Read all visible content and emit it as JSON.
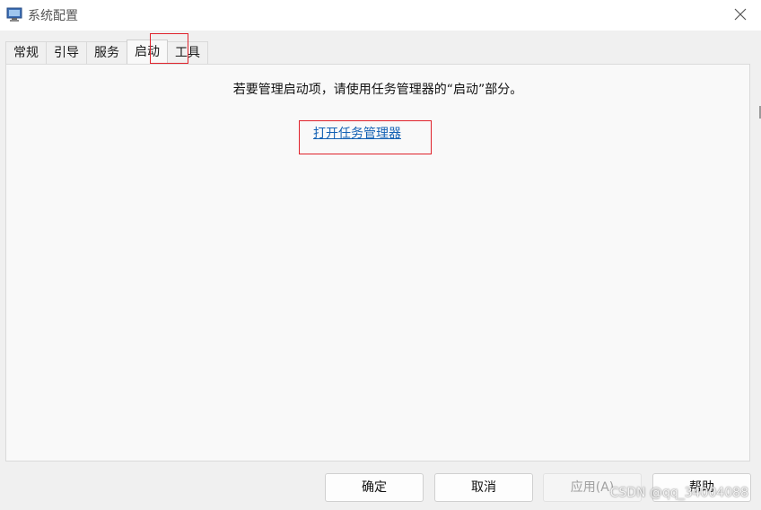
{
  "window": {
    "title": "系统配置",
    "close_icon": "close-icon",
    "app_icon": "system-config-icon"
  },
  "tabs": [
    {
      "label": "常规",
      "active": false
    },
    {
      "label": "引导",
      "active": false
    },
    {
      "label": "服务",
      "active": false
    },
    {
      "label": "启动",
      "active": true
    },
    {
      "label": "工具",
      "active": false
    }
  ],
  "startup": {
    "instruction": "若要管理启动项，请使用任务管理器的“启动”部分。",
    "link_label": "打开任务管理器"
  },
  "buttons": {
    "ok": "确定",
    "cancel": "取消",
    "apply": "应用(A)",
    "help": "帮助"
  },
  "watermark": "CSDN @qq_34004088",
  "colors": {
    "link": "#1361b4",
    "highlight_box": "#e0222b",
    "panel": "#f9f9f9"
  }
}
